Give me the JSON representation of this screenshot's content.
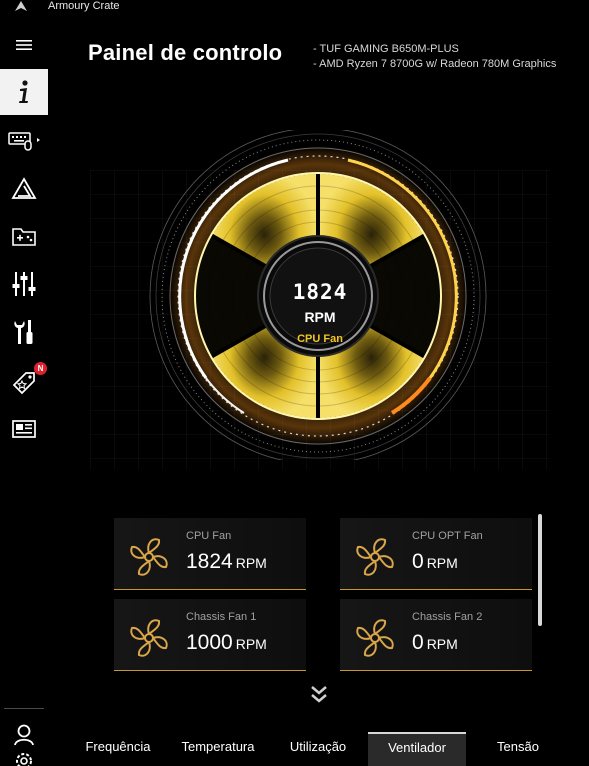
{
  "app": {
    "title": "Armoury Crate"
  },
  "sidebar": {
    "items": [
      {
        "name": "menu",
        "icon": "hamburger-menu-icon"
      },
      {
        "name": "info",
        "icon": "info-icon",
        "active": true
      },
      {
        "name": "device",
        "icon": "keyboard-mouse-icon"
      },
      {
        "name": "aura",
        "icon": "aura-sync-icon"
      },
      {
        "name": "game-library",
        "icon": "game-library-icon"
      },
      {
        "name": "scenario",
        "icon": "equalizer-sliders-icon"
      },
      {
        "name": "tools",
        "icon": "tools-icon"
      },
      {
        "name": "deals",
        "icon": "deals-tag-icon",
        "badge": "N"
      },
      {
        "name": "news",
        "icon": "news-icon"
      },
      {
        "name": "user",
        "icon": "user-icon"
      },
      {
        "name": "settings",
        "icon": "gear-icon"
      }
    ]
  },
  "header": {
    "title": "Painel de controlo",
    "hardware": [
      "TUF GAMING B650M-PLUS",
      "AMD Ryzen 7 8700G w/ Radeon 780M Graphics"
    ]
  },
  "gauge": {
    "rpm": "1824",
    "unit": "RPM",
    "label": "CPU Fan"
  },
  "fans": [
    {
      "name": "CPU Fan",
      "speed": "1824",
      "unit": "RPM"
    },
    {
      "name": "CPU OPT Fan",
      "speed": "0",
      "unit": "RPM"
    },
    {
      "name": "Chassis Fan 1",
      "speed": "1000",
      "unit": "RPM"
    },
    {
      "name": "Chassis Fan 2",
      "speed": "0",
      "unit": "RPM"
    }
  ],
  "tabs": [
    {
      "label": "Frequência"
    },
    {
      "label": "Temperatura"
    },
    {
      "label": "Utilização"
    },
    {
      "label": "Ventilador",
      "active": true
    },
    {
      "label": "Tensão"
    }
  ],
  "colors": {
    "accent": "#f2c523",
    "card_border": "#c8972b",
    "badge": "#e0202e"
  }
}
